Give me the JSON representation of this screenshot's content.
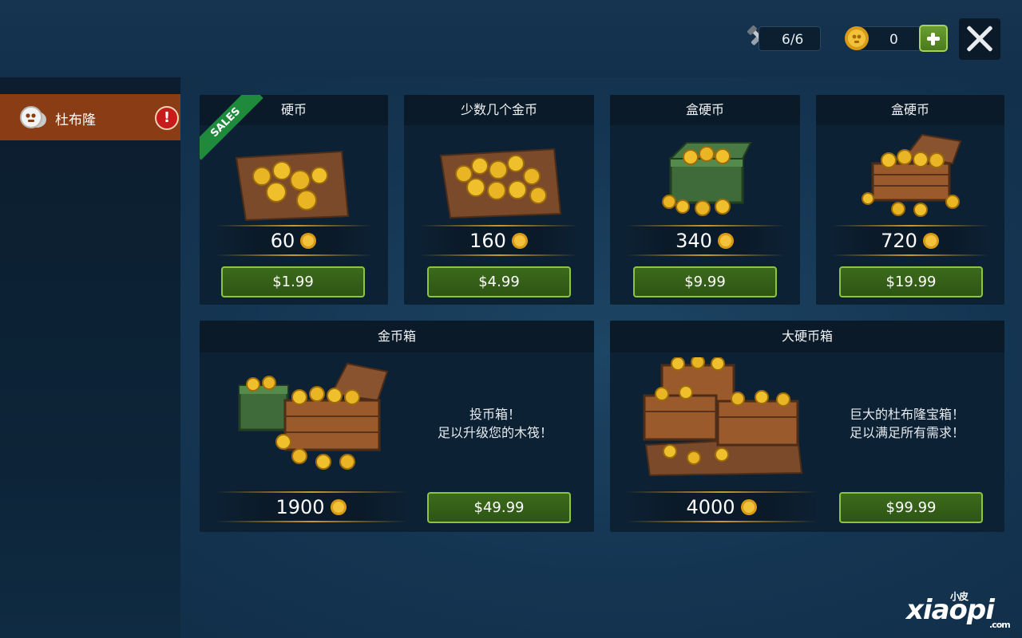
{
  "topbar": {
    "tools_value": "6/6",
    "coins_value": "0"
  },
  "sidebar": {
    "items": [
      {
        "label": "杜布隆",
        "alert": "!"
      }
    ]
  },
  "shop": {
    "sales_label": "SALES",
    "packs": [
      {
        "title": "硬币",
        "amount": "60",
        "price": "$1.99",
        "icon": "coin-pile-on-cloth"
      },
      {
        "title": "少数几个金币",
        "amount": "160",
        "price": "$4.99",
        "icon": "coin-heap-on-cloth"
      },
      {
        "title": "盒硬币",
        "amount": "340",
        "price": "$9.99",
        "icon": "green-box-of-coins"
      },
      {
        "title": "盒硬币",
        "amount": "720",
        "price": "$19.99",
        "icon": "wooden-crate-of-coins"
      },
      {
        "title": "金币箱",
        "amount": "1900",
        "price": "$49.99",
        "desc_line1": "投币箱！",
        "desc_line2": "足以升级您的木筏！",
        "icon": "coin-chests"
      },
      {
        "title": "大硬币箱",
        "amount": "4000",
        "price": "$99.99",
        "desc_line1": "巨大的杜布隆宝箱！",
        "desc_line2": "足以满足所有需求！",
        "icon": "big-coin-treasure"
      }
    ]
  },
  "watermark": {
    "main": "xiaopi",
    "small": "小皮",
    "suffix": ".com"
  },
  "colors": {
    "sidebar_active": "#8a3d14",
    "button_green": "#3c6a1c",
    "button_border": "#8cc53e",
    "sales_ribbon": "#1f8a3c",
    "card_bg": "#0d2134"
  }
}
